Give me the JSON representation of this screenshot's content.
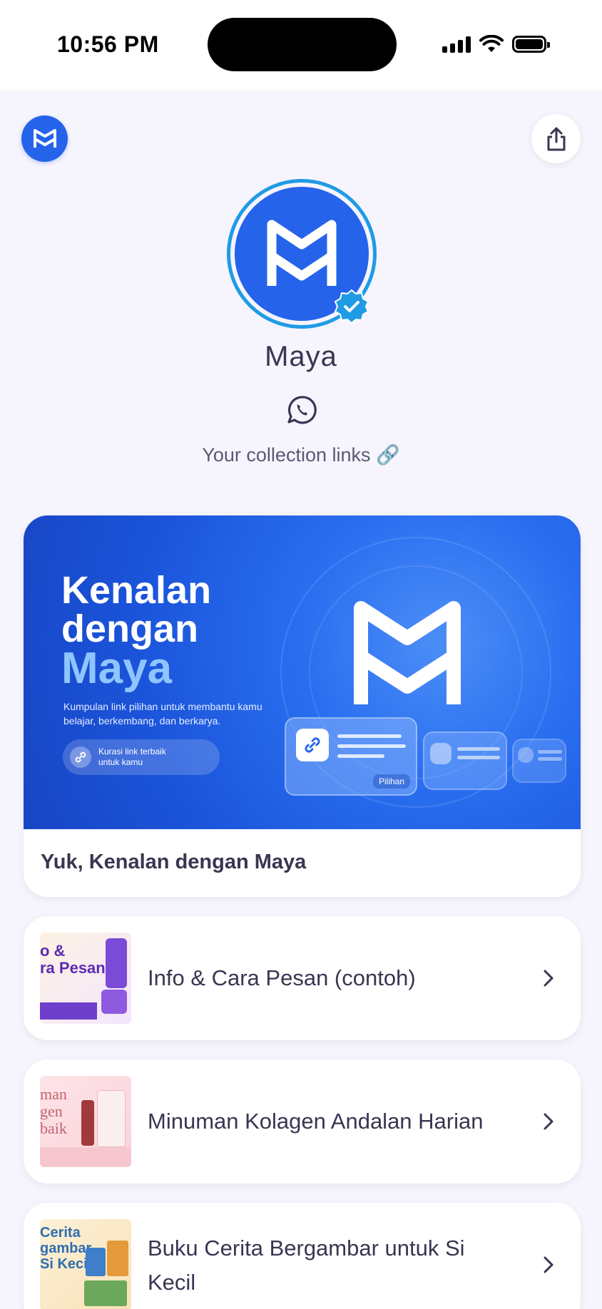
{
  "status_bar": {
    "time": "10:56 PM"
  },
  "profile": {
    "name": "Maya",
    "bio": "Your collection links 🔗"
  },
  "featured": {
    "banner_title_line1": "Kenalan",
    "banner_title_line2": "dengan",
    "banner_title_highlight": "Maya",
    "banner_subtitle": "Kumpulan link pilihan untuk membantu kamu belajar, berkembang, dan berkarya.",
    "banner_pill_text": "Kurasi link terbaik untuk kamu",
    "banner_chip": "Pilihan",
    "title": "Yuk, Kenalan dengan Maya"
  },
  "links": [
    {
      "label": "Info & Cara Pesan (contoh)",
      "thumb_text": "o &\nra Pesan"
    },
    {
      "label": "Minuman Kolagen Andalan Harian",
      "thumb_text": "man\ngen\nbaik"
    },
    {
      "label": "Buku Cerita Bergambar untuk Si Kecil",
      "thumb_text": "Cerita\ngambar\nSi Kecil"
    }
  ],
  "colors": {
    "brand": "#2563eb",
    "verified": "#1f9be6",
    "background": "#f6f4fc",
    "text": "#3a3551"
  },
  "icons": {
    "brand": "maya-logo-icon",
    "share": "share-icon",
    "whatsapp": "whatsapp-icon",
    "verified": "verified-badge-icon",
    "chevron": "chevron-right-icon"
  }
}
